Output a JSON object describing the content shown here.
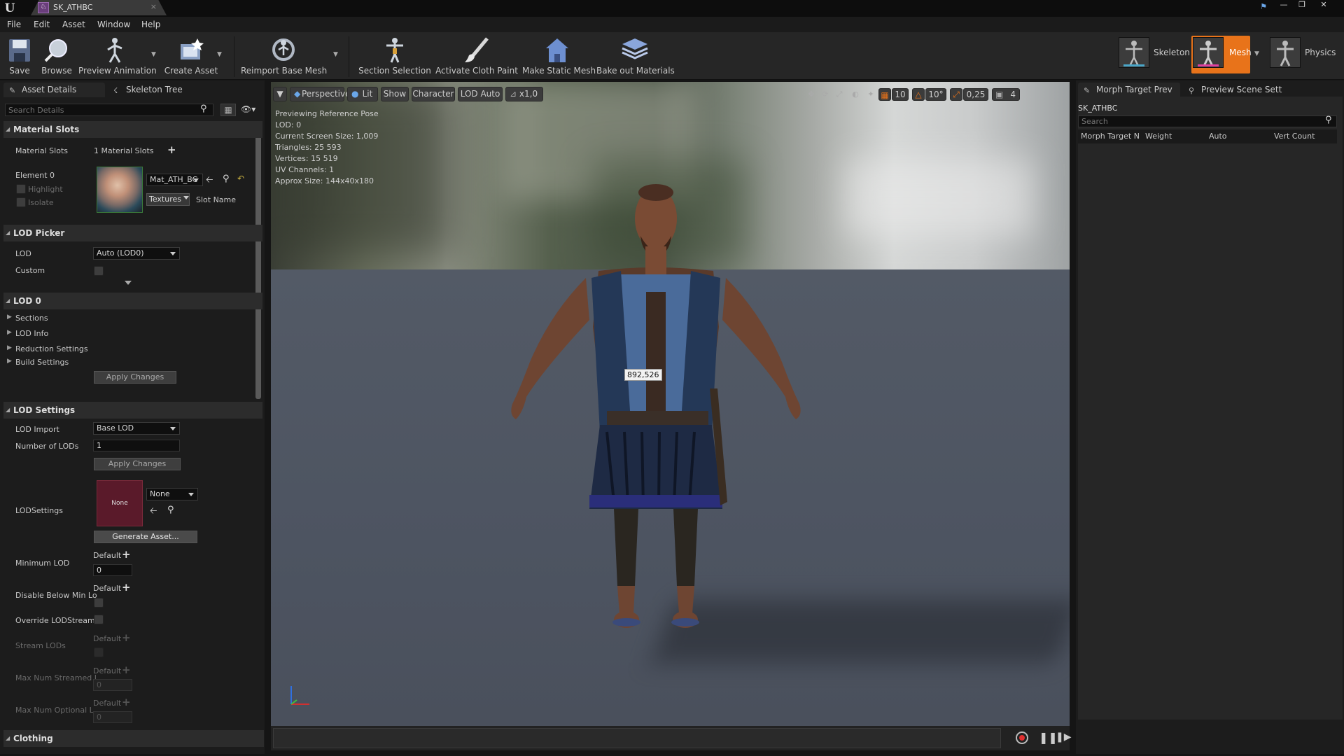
{
  "titlebar": {
    "logo": "U",
    "asset_tab": "SK_ATHBC",
    "tab_close": "×",
    "asset_icon": "skeletal-mesh-icon",
    "controls": {
      "minimize": "—",
      "maximize": "❐",
      "close": "✕"
    }
  },
  "menu": [
    "File",
    "Edit",
    "Asset",
    "Window",
    "Help"
  ],
  "toolbar": {
    "save": "Save",
    "browse": "Browse",
    "preview_animation": "Preview Animation",
    "create_asset": "Create Asset",
    "reimport": "Reimport Base Mesh",
    "section_selection": "Section Selection",
    "activate_cloth": "Activate Cloth Paint",
    "make_static": "Make Static Mesh",
    "bake_materials": "Bake out Materials",
    "modes": {
      "skeleton": "Skeleton",
      "mesh": "Mesh",
      "physics": "Physics"
    }
  },
  "left_tabs": {
    "asset_details": "Asset Details",
    "skeleton_tree": "Skeleton Tree"
  },
  "details": {
    "search_placeholder": "Search Details",
    "material_slots": {
      "header": "Material Slots",
      "label": "Material Slots",
      "count": "1 Material Slots",
      "element": "Element 0",
      "highlight": "Highlight",
      "isolate": "Isolate",
      "material": "Mat_ATH_BC",
      "textures": "Textures",
      "slot_name": "Slot Name"
    },
    "lod_picker": {
      "header": "LOD Picker",
      "lod": "LOD",
      "lod_value": "Auto (LOD0)",
      "custom": "Custom"
    },
    "lod0": {
      "header": "LOD 0",
      "sections": "Sections",
      "lod_info": "LOD Info",
      "reduction": "Reduction Settings",
      "build": "Build Settings",
      "apply": "Apply Changes"
    },
    "lod_settings": {
      "header": "LOD Settings",
      "lod_import": "LOD Import",
      "lod_import_value": "Base LOD",
      "num_lods": "Number of LODs",
      "num_lods_value": "1",
      "apply": "Apply Changes",
      "lodsettings": "LODSettings",
      "none_thumb": "None",
      "none_select": "None",
      "generate": "Generate Asset...",
      "min_lod": "Minimum LOD",
      "default": "Default",
      "zero": "0",
      "disable_below": "Disable Below Min Lo",
      "override": "Override LODStreami",
      "stream_lods": "Stream LODs",
      "max_streamed": "Max Num Streamed I",
      "max_optional": "Max Num Optional L"
    },
    "clothing": {
      "header": "Clothing"
    }
  },
  "viewport": {
    "buttons": {
      "perspective": "Perspective",
      "lit": "Lit",
      "show": "Show",
      "character": "Character",
      "lod_auto": "LOD Auto",
      "speed": "x1,0"
    },
    "right_buttons": {
      "grid": "10",
      "angle": "10°",
      "scale": "0,25",
      "camera": "4"
    },
    "info": [
      "Previewing Reference Pose",
      "LOD: 0",
      "Current Screen Size: 1,009",
      "Triangles: 25 593",
      "Vertices: 15 519",
      "UV Channels: 1",
      "Approx Size: 144x40x180"
    ],
    "tooltip": "892,526"
  },
  "right": {
    "tabs": {
      "morph": "Morph Target Prev",
      "scene": "Preview Scene Sett"
    },
    "asset_name": "SK_ATHBC",
    "search_placeholder": "Search",
    "columns": [
      "Morph Target N",
      "Weight",
      "Auto",
      "Vert Count"
    ]
  }
}
